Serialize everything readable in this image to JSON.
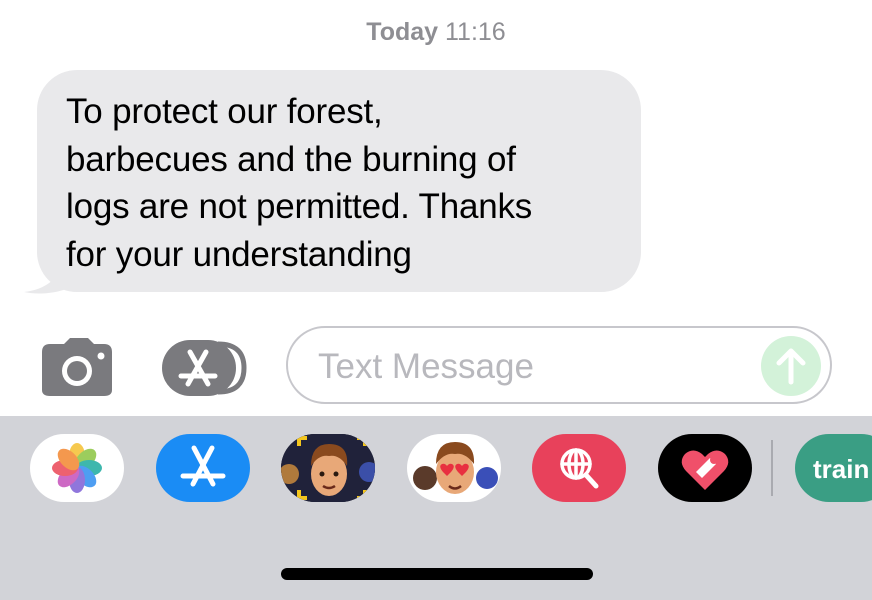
{
  "timestamp": {
    "day": "Today",
    "time": "11:16"
  },
  "message": {
    "text": "To protect our forest,\nbarbecues and the burning of\nlogs are not permitted. Thanks\nfor your understanding",
    "bubble_color": "#e9e9eb"
  },
  "compose": {
    "placeholder": "Text Message",
    "send_button_color": "#d3f2d9",
    "send_icon": "arrow-up-icon",
    "camera_icon": "camera-icon",
    "apps_icon": "app-store-icon"
  },
  "app_drawer": {
    "apps": [
      {
        "name": "Photos",
        "icon": "photos-icon"
      },
      {
        "name": "App Store",
        "icon": "app-store-icon",
        "color": "#1a8cf5"
      },
      {
        "name": "Memoji Stickers",
        "icon": "memoji-face-icon"
      },
      {
        "name": "Animoji",
        "icon": "memoji-heart-eyes-icon"
      },
      {
        "name": "Search Images",
        "icon": "globe-search-icon",
        "color": "#e8415b"
      },
      {
        "name": "Digital Touch",
        "icon": "heart-touch-icon",
        "color": "#000000"
      },
      {
        "name": "Trainline",
        "icon": "trainline-icon",
        "label": "train",
        "color": "#3a9e84"
      }
    ]
  }
}
